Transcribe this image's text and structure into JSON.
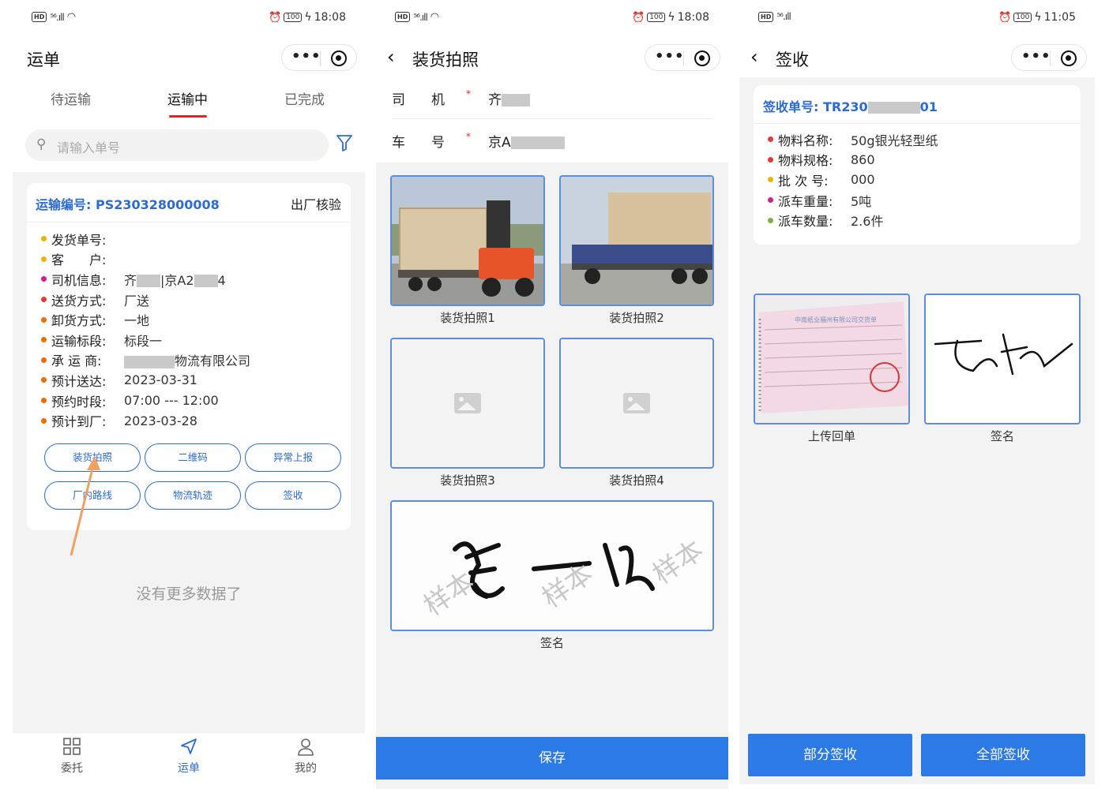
{
  "status_bar": {
    "p1": {
      "left_hd": "HD",
      "left_signal": "⁵⁶.ıll",
      "time": "18:08",
      "battery": "100"
    },
    "p2": {
      "left_hd": "HD",
      "left_signal": "⁵⁶.ıll",
      "time": "18:08",
      "battery": "100"
    },
    "p3": {
      "left_hd": "HD",
      "left_signal": "⁵⁶.ıll",
      "time": "11:05",
      "battery": "100"
    }
  },
  "panel1": {
    "title": "运单",
    "tabs": [
      "待运输",
      "运输中",
      "已完成"
    ],
    "active_tab": "运输中",
    "search_placeholder": "请输入单号",
    "card": {
      "number_label": "运输编号: PS230328000008",
      "status": "出厂核验",
      "rows": [
        {
          "key": "发货单号:",
          "value": "",
          "dot": "#f0b400"
        },
        {
          "key": "客　　户:",
          "value": "",
          "dot": "#f0b400"
        },
        {
          "key": "司机信息:",
          "value_a": "齐",
          "value_b": "|京A2",
          "value_c": "4",
          "dot": "#d81b8f"
        },
        {
          "key": "送货方式:",
          "value": "厂送",
          "dot": "#e53935"
        },
        {
          "key": "卸货方式:",
          "value": "一地",
          "dot": "#ef6c00"
        },
        {
          "key": "运输标段:",
          "value": "标段一",
          "dot": "#ef6c00"
        },
        {
          "key": "承 运 商:",
          "value_tail": "物流有限公司",
          "dot": "#ef6c00"
        },
        {
          "key": "预计送达:",
          "value": "2023-03-31",
          "dot": "#ef6c00"
        },
        {
          "key": "预约时段:",
          "value": "07:00 --- 12:00",
          "dot": "#ef6c00"
        },
        {
          "key": "预计到厂:",
          "value": "2023-03-28",
          "dot": "#ef6c00"
        }
      ],
      "buttons": [
        "装货拍照",
        "二维码",
        "异常上报",
        "厂内路线",
        "物流轨迹",
        "签收"
      ]
    },
    "no_more": "没有更多数据了",
    "tabbar": [
      {
        "label": "委托",
        "icon": "grid-icon"
      },
      {
        "label": "运单",
        "icon": "send-icon"
      },
      {
        "label": "我的",
        "icon": "user-icon"
      }
    ],
    "tabbar_active": "运单",
    "accent_color": "#2b6bd6",
    "tab_indicator_color": "#e0242c"
  },
  "panel2": {
    "title": "装货拍照",
    "driver_label": "司　机",
    "driver_value": "齐",
    "plate_label": "车　号",
    "plate_value": "京A",
    "photos": [
      "装货拍照1",
      "装货拍照2",
      "装货拍照3",
      "装货拍照4"
    ],
    "signature_label": "签名",
    "watermark": "样本",
    "save_button": "保存",
    "button_color": "#2b7ae6"
  },
  "panel3": {
    "title": "签收",
    "number_label": "签收单号: TR230",
    "number_tail": "01",
    "rows": [
      {
        "key": "物料名称:",
        "value": "50g银光轻型纸",
        "dot": "#e53935"
      },
      {
        "key": "物料规格:",
        "value": "860",
        "dot": "#e53935"
      },
      {
        "key": "批 次 号:",
        "value": "000",
        "dot": "#f0b400"
      },
      {
        "key": "派车重量:",
        "value": "5吨",
        "dot": "#d81b8f"
      },
      {
        "key": "派车数量:",
        "value": "2.6件",
        "dot": "#7cb342"
      }
    ],
    "receipt_label": "上传回单",
    "signature_label": "签名",
    "receipt_doc_title": "中南纸业福州有限公司交货单",
    "partial_button": "部分签收",
    "full_button": "全部签收"
  }
}
